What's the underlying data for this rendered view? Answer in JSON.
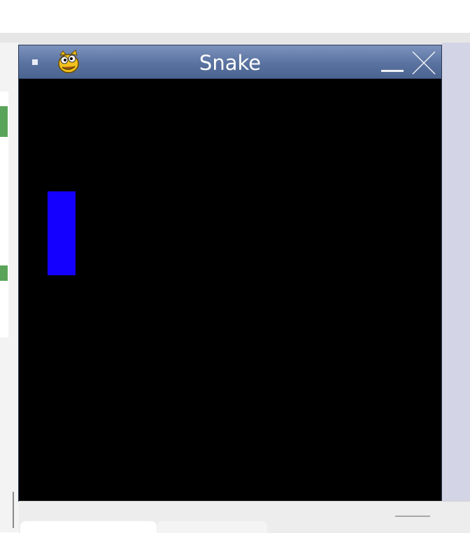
{
  "window": {
    "title": "Snake",
    "app_icon": "pygame-snake-icon",
    "menu_icon": "window-menu-icon",
    "minimize_icon": "minimize-icon",
    "close_icon": "close-icon"
  },
  "game": {
    "background_color": "#000000",
    "snake_color": "#1400ff",
    "snake_segments": [
      {
        "col": 1,
        "row": 4
      },
      {
        "col": 1,
        "row": 5
      },
      {
        "col": 1,
        "row": 6
      }
    ],
    "grid_cell_size_label": "40"
  },
  "colors": {
    "titlebar": "#5a72a0",
    "side_panel": "#d3d4e6",
    "accent_green": "#5aa45a"
  }
}
